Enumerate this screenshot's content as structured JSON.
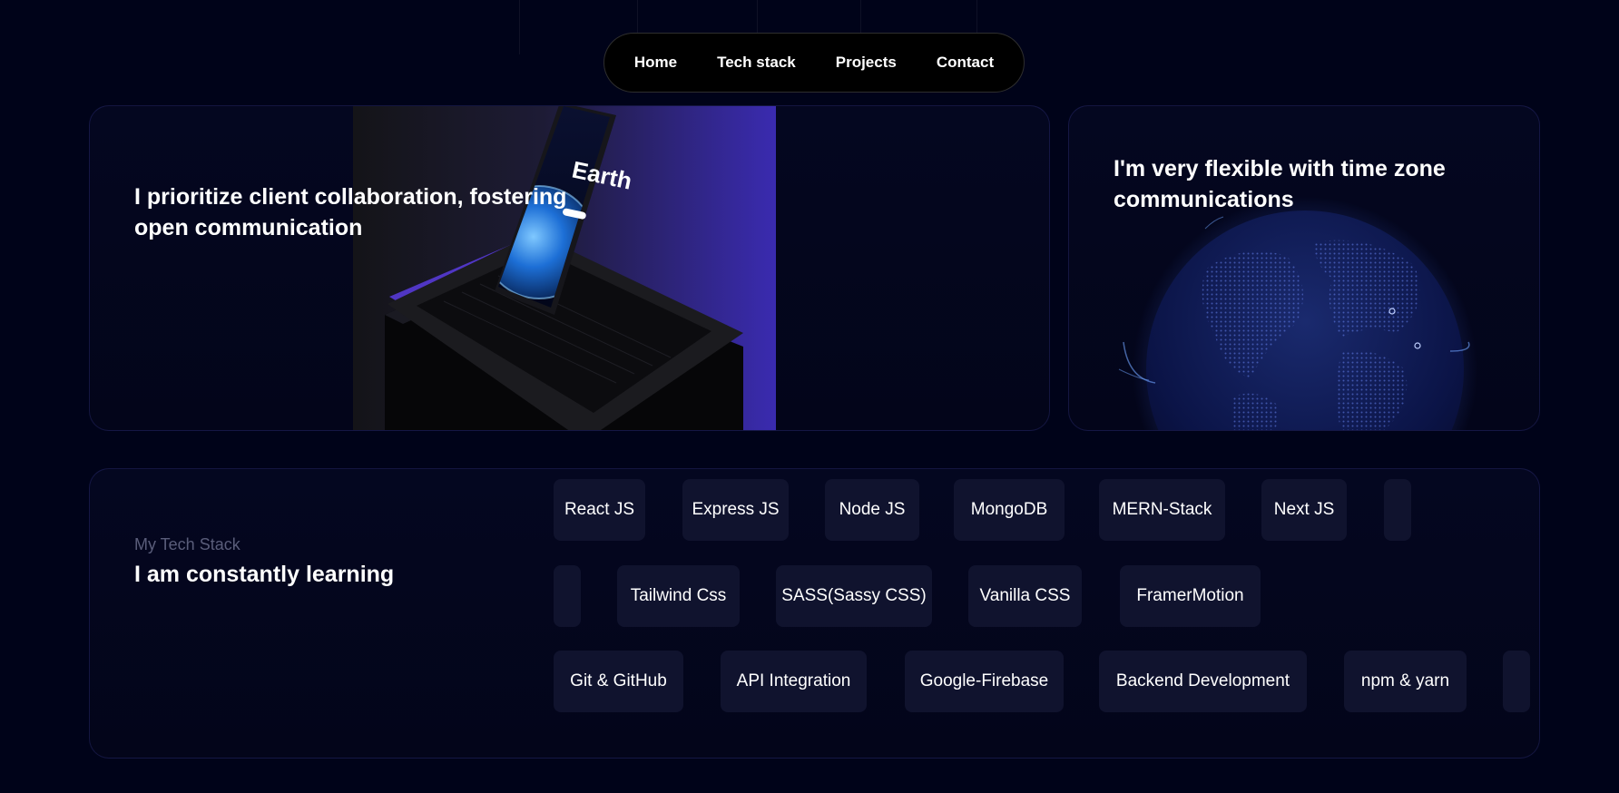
{
  "nav": {
    "items": [
      "Home",
      "Tech stack",
      "Projects",
      "Contact"
    ]
  },
  "collab_card": {
    "title": "I prioritize client collaboration, fostering open communication",
    "laptop_screen_text": "Earth"
  },
  "timezone_card": {
    "title": "I'm very flexible with time zone communications"
  },
  "tech_card": {
    "subtitle": "My Tech Stack",
    "heading": "I am constantly learning",
    "row1": [
      "React JS",
      "Express JS",
      "Node JS",
      "MongoDB",
      "MERN-Stack",
      "Next JS"
    ],
    "row2": [
      "Tailwind Css",
      "SASS(Sassy CSS)",
      "Vanilla CSS",
      "FramerMotion"
    ],
    "row3": [
      "Git & GitHub",
      "API Integration",
      "Google-Firebase",
      "Backend Development",
      "npm & yarn"
    ]
  },
  "colors": {
    "background": "#000319",
    "card": "#040720",
    "pill": "#10132e",
    "accent": "#3a2bb0"
  }
}
